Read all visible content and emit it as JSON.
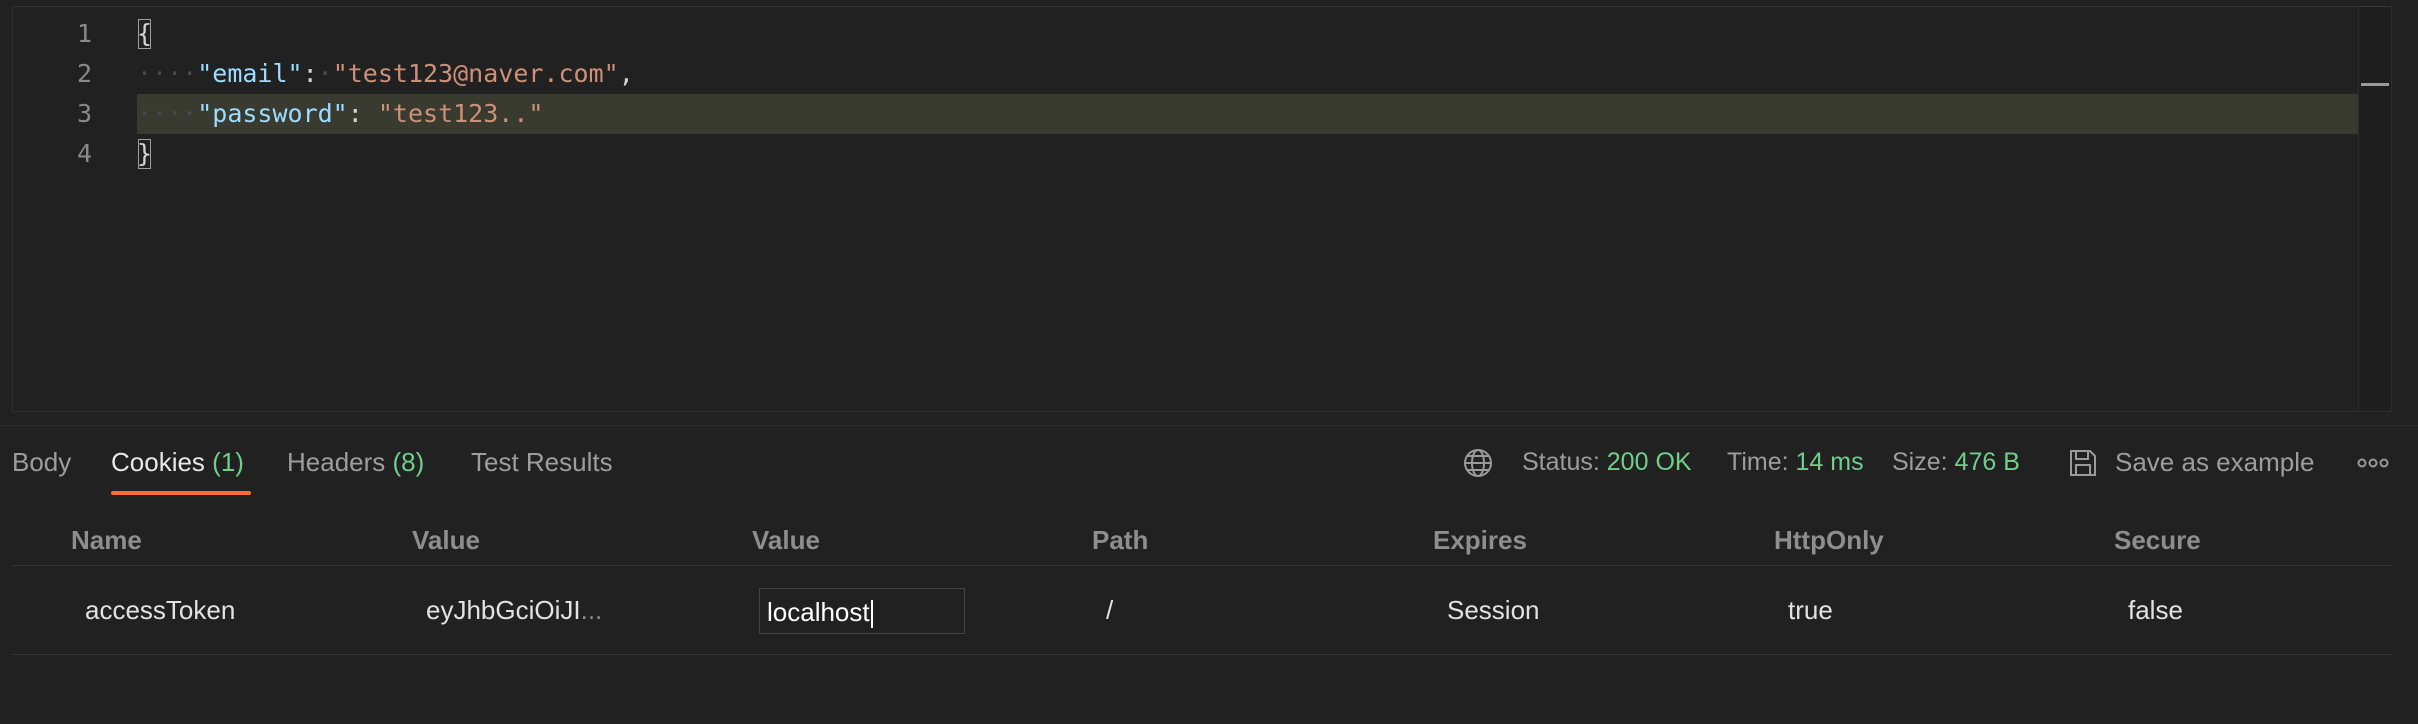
{
  "editor": {
    "line_numbers": [
      "1",
      "2",
      "3",
      "4"
    ],
    "lines": {
      "l1": {
        "brace": "{"
      },
      "l2": {
        "ws_indent": "····",
        "key": "\"email\"",
        "colon": ":",
        "ws_sep": "·",
        "value": "\"test123@naver.com\"",
        "comma": ","
      },
      "l3": {
        "ws_indent": "····",
        "key": "\"password\"",
        "colon": ":",
        "sep": " ",
        "value": "\"test123..\""
      },
      "l4": {
        "brace": "}"
      }
    }
  },
  "response": {
    "tabs": {
      "body": {
        "label": "Body"
      },
      "cookies": {
        "label": "Cookies",
        "count": "(1)"
      },
      "headers": {
        "label": "Headers",
        "count": "(8)"
      },
      "tests": {
        "label": "Test Results"
      }
    },
    "status": {
      "label": "Status:",
      "value": "200 OK"
    },
    "time": {
      "label": "Time:",
      "value": "14 ms"
    },
    "size": {
      "label": "Size:",
      "value": "476 B"
    },
    "save_example_label": "Save as example",
    "icons": {
      "network": "globe-icon",
      "save": "floppy-disk-icon",
      "more": "more-options-icon"
    },
    "colors": {
      "accent": "#ff6c37",
      "success": "#6fcf8a"
    }
  },
  "cookies_table": {
    "headers": [
      "Name",
      "Value",
      "Value",
      "Path",
      "Expires",
      "HttpOnly",
      "Secure"
    ],
    "rows": [
      {
        "name": "accessToken",
        "value": "eyJhbGciOiJI",
        "value_ellipsis": "...",
        "domain": "localhost",
        "path": "/",
        "expires": "Session",
        "httponly": "true",
        "secure": "false"
      }
    ]
  }
}
